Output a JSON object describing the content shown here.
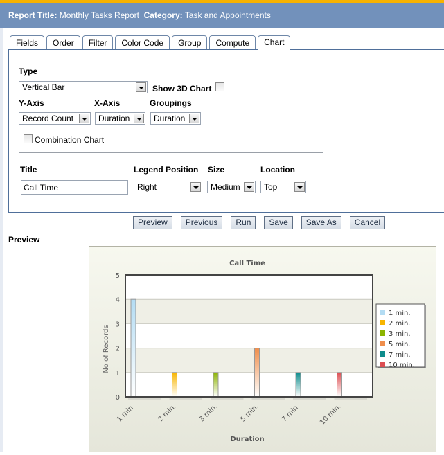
{
  "header": {
    "report_title_label": "Report Title:",
    "report_title_value": "Monthly Tasks Report",
    "category_label": "Category:",
    "category_value": "Task and Appointments"
  },
  "tabs": [
    {
      "label": "Fields",
      "active": false
    },
    {
      "label": "Order",
      "active": false
    },
    {
      "label": "Filter",
      "active": false
    },
    {
      "label": "Color Code",
      "active": false
    },
    {
      "label": "Group",
      "active": false
    },
    {
      "label": "Compute",
      "active": false
    },
    {
      "label": "Chart",
      "active": true
    }
  ],
  "form": {
    "type_label": "Type",
    "type_value": "Vertical Bar",
    "show3d_label": "Show 3D Chart",
    "show3d_checked": false,
    "yaxis_label": "Y-Axis",
    "yaxis_value": "Record Count",
    "xaxis_label": "X-Axis",
    "xaxis_value": "Duration",
    "groupings_label": "Groupings",
    "groupings_value": "Duration",
    "combination_label": "Combination Chart",
    "combination_checked": false,
    "title_label": "Title",
    "title_value": "Call Time",
    "legend_position_label": "Legend Position",
    "legend_position_value": "Right",
    "size_label": "Size",
    "size_value": "Medium",
    "location_label": "Location",
    "location_value": "Top"
  },
  "buttons": {
    "preview": "Preview",
    "previous": "Previous",
    "run": "Run",
    "save": "Save",
    "save_as": "Save As",
    "cancel": "Cancel"
  },
  "preview_label": "Preview",
  "chart_data": {
    "type": "bar",
    "title": "Call Time",
    "xlabel": "Duration",
    "ylabel": "No of Records",
    "categories": [
      "1 min.",
      "2 min.",
      "3 min.",
      "5 min.",
      "7 min.",
      "10 min."
    ],
    "values": [
      4,
      1,
      1,
      2,
      1,
      1
    ],
    "colors": [
      "#b3dcf3",
      "#f7b500",
      "#8cb400",
      "#ef8e4c",
      "#0e8c8c",
      "#dc4e52"
    ],
    "ylim": [
      0,
      5
    ],
    "yticks": [
      0,
      1,
      2,
      3,
      4,
      5
    ],
    "grid": true,
    "legend": {
      "position": "right",
      "entries": [
        "1 min.",
        "2 min.",
        "3 min.",
        "5 min.",
        "7 min.",
        "10 min."
      ]
    }
  }
}
